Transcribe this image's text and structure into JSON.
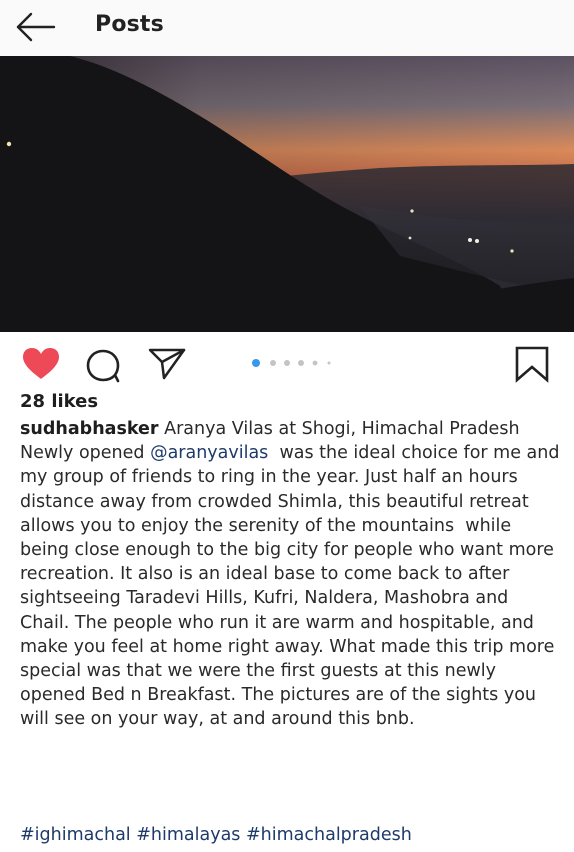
{
  "header": {
    "title": "Posts"
  },
  "post": {
    "likes": "28 likes",
    "username": "sudhabhasker",
    "location": "Aranya Vilas at Shogi, Himachal Pradesh",
    "caption_before_mention": "Newly opened ",
    "mention": "@aranyavilas",
    "caption_after_mention": "  was the ideal choice for me and my group of friends to ring in the year. Just half an hours distance away from crowded Shimla, this beautiful retreat allows you to enjoy the serenity of the mountains  while being close enough to the big city for people who want more recreation. It also is an ideal base to come back to after sightseeing Taradevi Hills, Kufri, Naldera, Mashobra and Chail. The people who run it are warm and hospitable, and make you feel at home right away. What made this trip more special was that we were the first guests at this newly opened Bed n Breakfast. The pictures are of the sights you will see on your way, at and around this bnb.",
    "hashtags": [
      "#ighimachal",
      "#himalayas",
      "#himachalpradesh"
    ],
    "liked": true,
    "carousel": {
      "total": 6,
      "current": 1
    }
  },
  "colors": {
    "like_red": "#ed4956",
    "carousel_active": "#3897f0",
    "carousel_inactive": "#c4c4c4",
    "link_blue": "#1e3a6b"
  },
  "icons": {
    "back": "arrow-left-icon",
    "like": "heart-icon",
    "comment": "comment-bubble-icon",
    "share": "paper-plane-icon",
    "save": "bookmark-icon"
  }
}
